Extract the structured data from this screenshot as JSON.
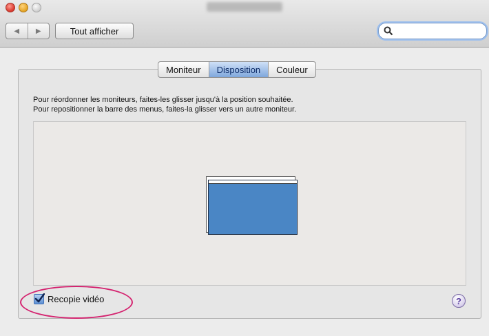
{
  "window": {
    "title": ""
  },
  "toolbar": {
    "back_icon": "◀",
    "forward_icon": "▶",
    "show_all_label": "Tout afficher",
    "search_value": "",
    "search_placeholder": ""
  },
  "tabs": [
    {
      "label": "Moniteur",
      "active": false
    },
    {
      "label": "Disposition",
      "active": true
    },
    {
      "label": "Couleur",
      "active": false
    }
  ],
  "instructions": {
    "line1": "Pour réordonner les moniteurs, faites-les glisser jusqu'à la position souhaitée.",
    "line2": "Pour repositionner la barre des menus, faites-la glisser vers un autre moniteur."
  },
  "mirror": {
    "label": "Recopie vidéo",
    "checked": true
  },
  "help": {
    "label": "?"
  },
  "colors": {
    "monitor_fill": "#4a86c5",
    "highlight": "#d4236f",
    "tab_active": "#7fa7dc"
  }
}
